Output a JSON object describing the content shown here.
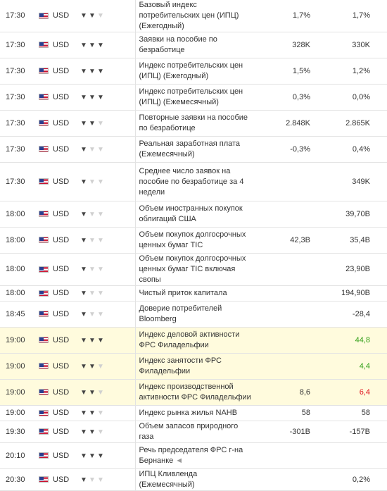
{
  "colors": {
    "green": "#34a01a",
    "red": "#e0141e",
    "highlight": "#fffbdd"
  },
  "icons": {
    "flag": "us-flag-icon",
    "importance": "bull-icon",
    "speech": "speaker-icon"
  },
  "rows": [
    {
      "time": "17:30",
      "currency": "USD",
      "importance": 2,
      "event": "Базовый индекс потребительских цен (ИПЦ) (Ежегодный)",
      "actual": "",
      "forecast": "1,7%",
      "previous": "1,7%",
      "prev_color": "",
      "hl": false,
      "speech": false
    },
    {
      "time": "17:30",
      "currency": "USD",
      "importance": 3,
      "event": "Заявки на пособие по безработице",
      "actual": "",
      "forecast": "328K",
      "previous": "330K",
      "prev_color": "",
      "hl": false,
      "speech": false
    },
    {
      "time": "17:30",
      "currency": "USD",
      "importance": 3,
      "event": "Индекс потребительских цен (ИПЦ) (Ежегодный)",
      "actual": "",
      "forecast": "1,5%",
      "previous": "1,2%",
      "prev_color": "",
      "hl": false,
      "speech": false
    },
    {
      "time": "17:30",
      "currency": "USD",
      "importance": 3,
      "event": "Индекс потребительских цен (ИПЦ) (Ежемесячный)",
      "actual": "",
      "forecast": "0,3%",
      "previous": "0,0%",
      "prev_color": "",
      "hl": false,
      "speech": false
    },
    {
      "time": "17:30",
      "currency": "USD",
      "importance": 2,
      "event": "Повторные заявки на пособие по безработице",
      "actual": "",
      "forecast": "2.848K",
      "previous": "2.865K",
      "prev_color": "",
      "hl": false,
      "speech": false
    },
    {
      "time": "17:30",
      "currency": "USD",
      "importance": 1,
      "event": "Реальная заработная плата (Ежемесячный)",
      "actual": "",
      "forecast": "-0,3%",
      "previous": "0,4%",
      "prev_color": "",
      "hl": false,
      "speech": false
    },
    {
      "time": "17:30",
      "currency": "USD",
      "importance": 1,
      "event": "Среднее число заявок на пособие по безработице за 4 недели",
      "actual": "",
      "forecast": "",
      "previous": "349K",
      "prev_color": "",
      "hl": false,
      "speech": false
    },
    {
      "time": "18:00",
      "currency": "USD",
      "importance": 1,
      "event": "Объем иностранных покупок облигаций США",
      "actual": "",
      "forecast": "",
      "previous": "39,70B",
      "prev_color": "",
      "hl": false,
      "speech": false
    },
    {
      "time": "18:00",
      "currency": "USD",
      "importance": 1,
      "event": "Объем покупок долгосрочных ценных бумаг TIC",
      "actual": "",
      "forecast": "42,3B",
      "previous": "35,4B",
      "prev_color": "",
      "hl": false,
      "speech": false
    },
    {
      "time": "18:00",
      "currency": "USD",
      "importance": 1,
      "event": "Объем покупок долгосрочных ценных бумаг TIC включая свопы",
      "actual": "",
      "forecast": "",
      "previous": "23,90B",
      "prev_color": "",
      "hl": false,
      "speech": false
    },
    {
      "time": "18:00",
      "currency": "USD",
      "importance": 1,
      "event": "Чистый приток капитала",
      "actual": "",
      "forecast": "",
      "previous": "194,90B",
      "prev_color": "",
      "hl": false,
      "speech": false
    },
    {
      "time": "18:45",
      "currency": "USD",
      "importance": 1,
      "event": "Доверие потребителей Bloomberg",
      "actual": "",
      "forecast": "",
      "previous": "-28,4",
      "prev_color": "",
      "hl": false,
      "speech": false
    },
    {
      "time": "19:00",
      "currency": "USD",
      "importance": 3,
      "event": "Индекс деловой активности ФРС Филадельфии",
      "actual": "",
      "forecast": "",
      "previous": "44,8",
      "prev_color": "green",
      "hl": true,
      "speech": false
    },
    {
      "time": "19:00",
      "currency": "USD",
      "importance": 2,
      "event": "Индекс занятости ФРС Филадельфии",
      "actual": "",
      "forecast": "",
      "previous": "4,4",
      "prev_color": "green",
      "hl": true,
      "speech": false
    },
    {
      "time": "19:00",
      "currency": "USD",
      "importance": 2,
      "event": "Индекс производственной активности ФРС Филадельфии",
      "actual": "",
      "forecast": "8,6",
      "previous": "6,4",
      "prev_color": "red",
      "hl": true,
      "speech": false
    },
    {
      "time": "19:00",
      "currency": "USD",
      "importance": 2,
      "event": "Индекс рынка жилья NAHB",
      "actual": "",
      "forecast": "58",
      "previous": "58",
      "prev_color": "",
      "hl": false,
      "speech": false
    },
    {
      "time": "19:30",
      "currency": "USD",
      "importance": 2,
      "event": "Объем запасов природного газа",
      "actual": "",
      "forecast": "-301B",
      "previous": "-157B",
      "prev_color": "",
      "hl": false,
      "speech": false
    },
    {
      "time": "20:10",
      "currency": "USD",
      "importance": 3,
      "event": "Речь председателя ФРС г-на Бернанке",
      "actual": "",
      "forecast": "",
      "previous": "",
      "prev_color": "",
      "hl": false,
      "speech": true
    },
    {
      "time": "20:30",
      "currency": "USD",
      "importance": 1,
      "event": "ИПЦ Кливленда (Ежемесячный)",
      "actual": "",
      "forecast": "",
      "previous": "0,2%",
      "prev_color": "",
      "hl": false,
      "speech": false
    }
  ]
}
